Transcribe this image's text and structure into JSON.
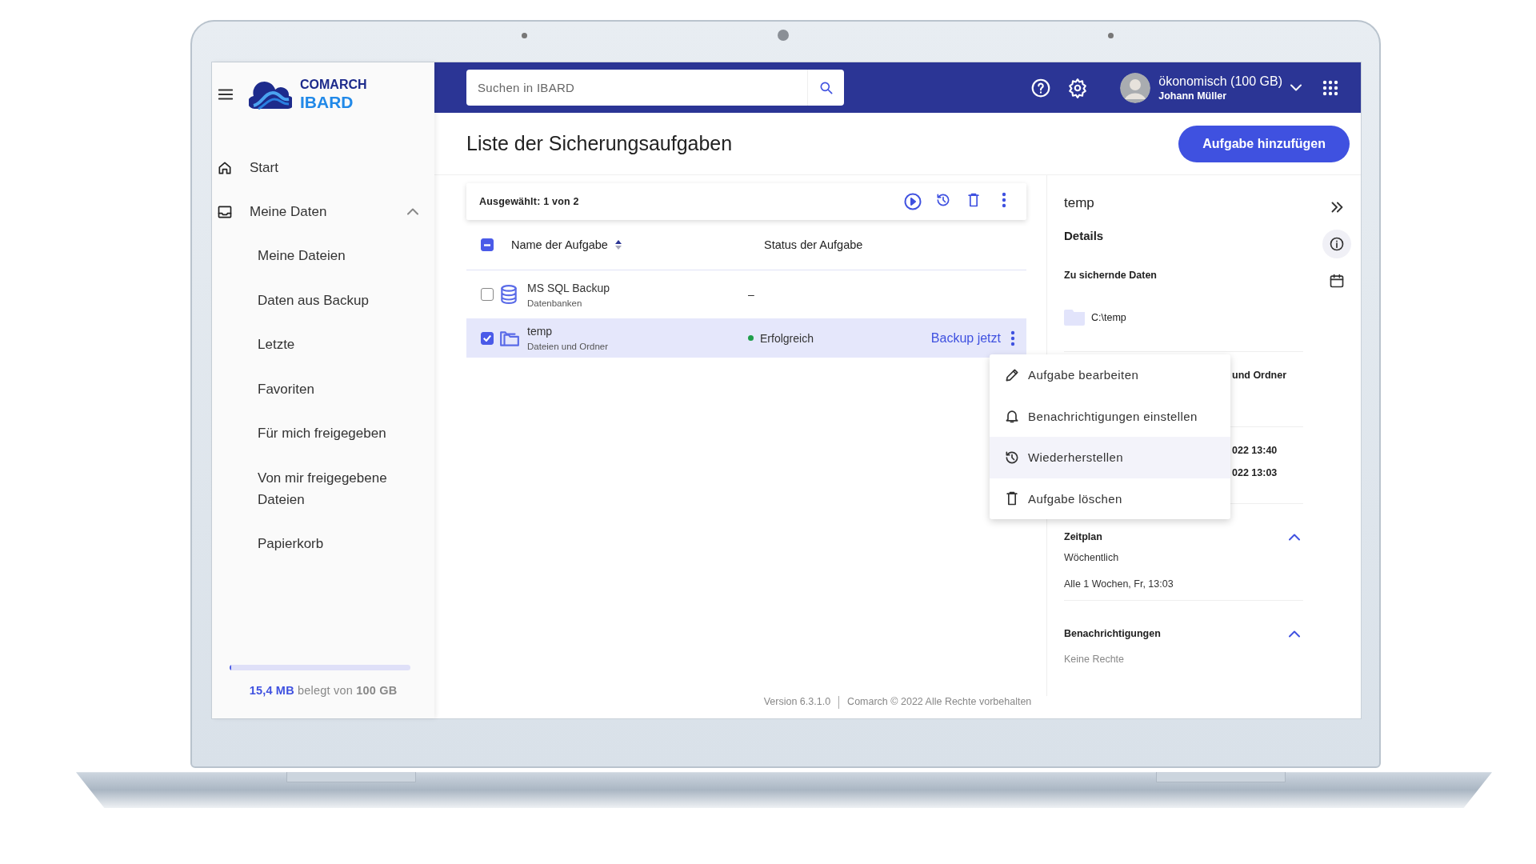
{
  "sidebar": {
    "logo": {
      "brand": "COMARCH",
      "product": "IBARD"
    },
    "items": [
      {
        "kind": "link",
        "label": "Start"
      },
      {
        "kind": "group",
        "label": "Meine Daten",
        "expanded": true,
        "children": [
          {
            "label": "Meine Dateien"
          },
          {
            "label": "Daten aus Backup"
          },
          {
            "label": "Letzte"
          },
          {
            "label": "Favoriten"
          },
          {
            "label": "Für mich freigegeben"
          },
          {
            "label": "Von mir freigegebene Dateien"
          },
          {
            "label": "Papierkorb"
          }
        ]
      }
    ],
    "storage": {
      "used": "15,4 MB",
      "label": "belegt von",
      "total": "100 GB",
      "level": 0.01
    }
  },
  "header": {
    "search": {
      "placeholder": "Suchen in IBARD"
    },
    "account": {
      "plan": "ökonomisch (100 GB)",
      "user": "Johann Müller"
    }
  },
  "page": {
    "title": "Liste der Sicherungsaufgaben",
    "add_button": "Aufgabe hinzufügen"
  },
  "tasks": {
    "selection": "Ausgewählt: 1 von 2",
    "select_all_checked": true,
    "select_all_partial": true,
    "columns": [
      {
        "label": "Name der Aufgabe",
        "sorted": true
      },
      {
        "label": "Status der Aufgabe",
        "sorted": false
      }
    ],
    "rows": [
      {
        "kind": "database",
        "name": "MS SQL Backup",
        "type": "Datenbanken",
        "status": "–",
        "selected": false
      },
      {
        "kind": "folder",
        "name": "temp",
        "type": "Dateien und Ordner",
        "status": "Erfolgreich",
        "color": "#1e9e4a",
        "selected": true,
        "action": "Backup jetzt"
      }
    ]
  },
  "context_menu": {
    "items": [
      {
        "kind": "edit",
        "label": "Aufgabe bearbeiten",
        "selected": false
      },
      {
        "kind": "bell",
        "label": "Benachrichtigungen einstellen",
        "selected": false
      },
      {
        "kind": "history",
        "label": "Wiederherstellen",
        "selected": true
      },
      {
        "kind": "trash",
        "label": "Aufgabe löschen",
        "selected": false
      }
    ]
  },
  "details": {
    "title": "temp",
    "heading": "Details",
    "source": {
      "heading": "Zu sichernde Daten",
      "path": "C:\\temp"
    },
    "partial_groups": [
      [
        "und Ordner"
      ],
      [
        "022 13:40",
        "022 13:03"
      ]
    ],
    "sections": [
      {
        "heading": "Zeitplan",
        "expanded": true,
        "muted": false,
        "lines": [
          "Wöchentlich",
          "Alle 1 Wochen, Fr, 13:03"
        ]
      },
      {
        "heading": "Benachrichtigungen",
        "expanded": true,
        "muted": true,
        "lines": [
          "Keine Rechte"
        ]
      }
    ]
  },
  "rail": [
    {
      "kind": "collapse",
      "selected": false
    },
    {
      "kind": "info",
      "selected": true
    },
    {
      "kind": "calendar",
      "selected": false
    }
  ],
  "footer": {
    "version": "Version 6.3.1.0",
    "copyright": "Comarch © 2022 Alle Rechte vorbehalten"
  }
}
